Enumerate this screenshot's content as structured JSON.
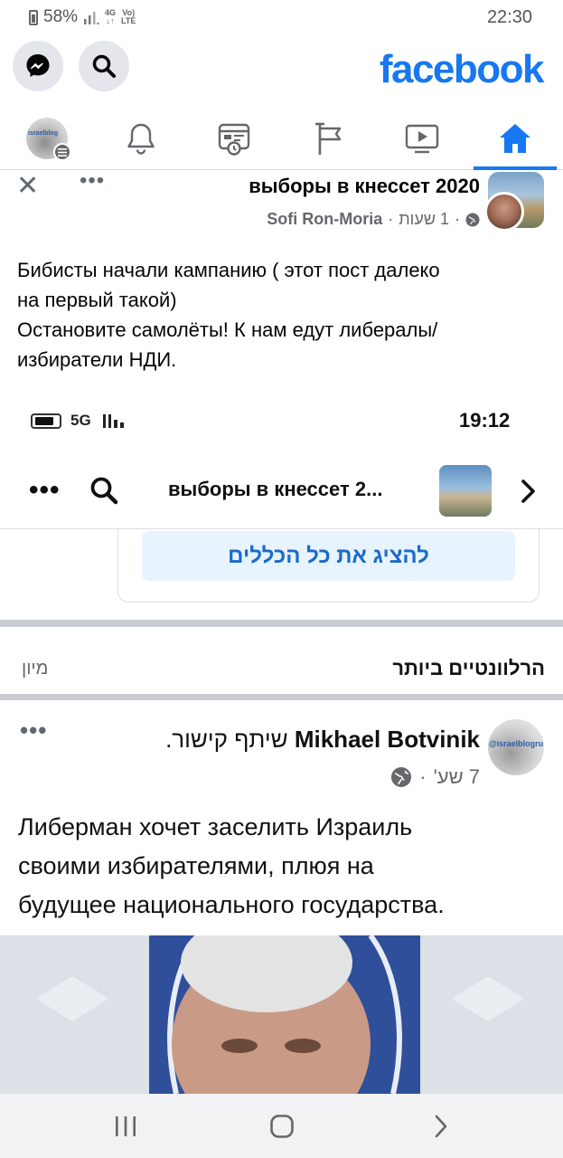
{
  "status_bar": {
    "battery": "58%",
    "signal_tag_top": "4G",
    "volte_top": "Vo)",
    "volte_bottom": "LTE",
    "time": "22:30"
  },
  "header": {
    "logo": "facebook",
    "messenger_icon": "messenger-icon",
    "search_icon": "search-icon",
    "accent": "#1877f2"
  },
  "tabs": [
    {
      "icon": "profile-avatar",
      "badge": "israelblog"
    },
    {
      "icon": "bell-icon"
    },
    {
      "icon": "news-icon"
    },
    {
      "icon": "flag-icon"
    },
    {
      "icon": "video-icon"
    },
    {
      "icon": "home-icon",
      "active": true
    }
  ],
  "post": {
    "group_name": "выборы в кнессет 2020",
    "author": "Sofi Ron-Moria",
    "time": "1 שעות",
    "separator": "·",
    "text_lines": [
      "Бибисты начали кампанию ( этот пост далеко",
      "на первый такой)",
      "Остановите самолёты! К нам едут  либералы/",
      "избиратели НДИ."
    ]
  },
  "embedded": {
    "network": "5G",
    "time": "19:12",
    "title": "выборы в кнессет 2...",
    "show_all_rules": "להציג את כל הכללים",
    "sort_label": "מיון",
    "most_relevant": "הרלוונטיים ביותר",
    "inner_post": {
      "author": "Mikhael Botvinik",
      "action": "שיתף קישור.",
      "time": "7 שע'",
      "separator": "·",
      "avatar_text": "@israelblogru",
      "text_lines": [
        "Либерман хочет заселить Израиль",
        "своими избирателями, плюя на",
        "будущее национального государства."
      ]
    }
  }
}
